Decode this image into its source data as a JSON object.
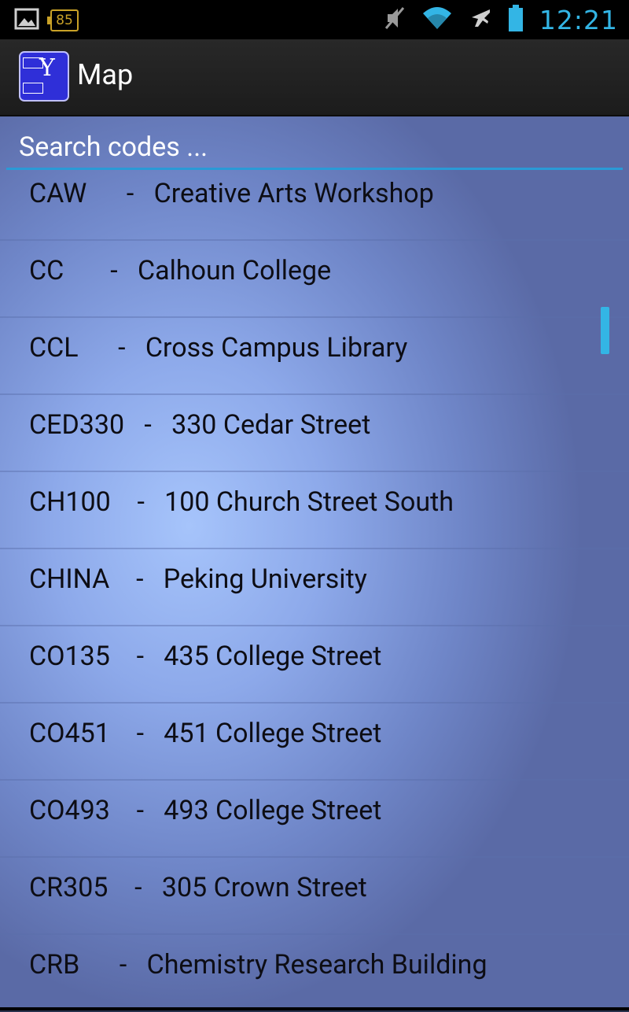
{
  "status_bar": {
    "battery_level_label": "85",
    "time": "12:21",
    "icons": [
      "image-notification-icon",
      "battery-level-icon",
      "muted-icon",
      "wifi-icon",
      "airplane-mode-icon",
      "battery-icon"
    ]
  },
  "action_bar": {
    "title": "Map",
    "app_icon": "yale-app-icon"
  },
  "search": {
    "placeholder": "Search codes ...",
    "value": ""
  },
  "list": {
    "items": [
      {
        "code": "CAW",
        "separator": "-",
        "name": "Creative Arts Workshop"
      },
      {
        "code": "CC",
        "separator": "-",
        "name": "Calhoun College"
      },
      {
        "code": "CCL",
        "separator": "-",
        "name": "Cross Campus Library"
      },
      {
        "code": "CED330",
        "separator": "-",
        "name": "330 Cedar Street"
      },
      {
        "code": "CH100",
        "separator": "-",
        "name": "100 Church Street South"
      },
      {
        "code": "CHINA",
        "separator": "-",
        "name": "Peking University"
      },
      {
        "code": "CO135",
        "separator": "-",
        "name": "435 College Street"
      },
      {
        "code": "CO451",
        "separator": "-",
        "name": "451 College Street"
      },
      {
        "code": "CO493",
        "separator": "-",
        "name": "493 College Street"
      },
      {
        "code": "CR305",
        "separator": "-",
        "name": "305 Crown Street"
      },
      {
        "code": "CRB",
        "separator": "-",
        "name": "Chemistry Research Building"
      }
    ],
    "display": [
      "CAW      -   Creative Arts Workshop",
      "CC       -   Calhoun College",
      "CCL      -   Cross Campus Library",
      "CED330   -   330 Cedar Street",
      "CH100    -   100 Church Street South",
      "CHINA    -   Peking University",
      "CO135    -   435 College Street",
      "CO451    -   451 College Street",
      "CO493    -   493 College Street",
      "CR305    -   305 Crown Street",
      "CRB      -   Chemistry Research Building"
    ]
  },
  "colors": {
    "accent": "#33b5e5",
    "action_bar": "#222222",
    "list_text": "#0d0d14"
  }
}
